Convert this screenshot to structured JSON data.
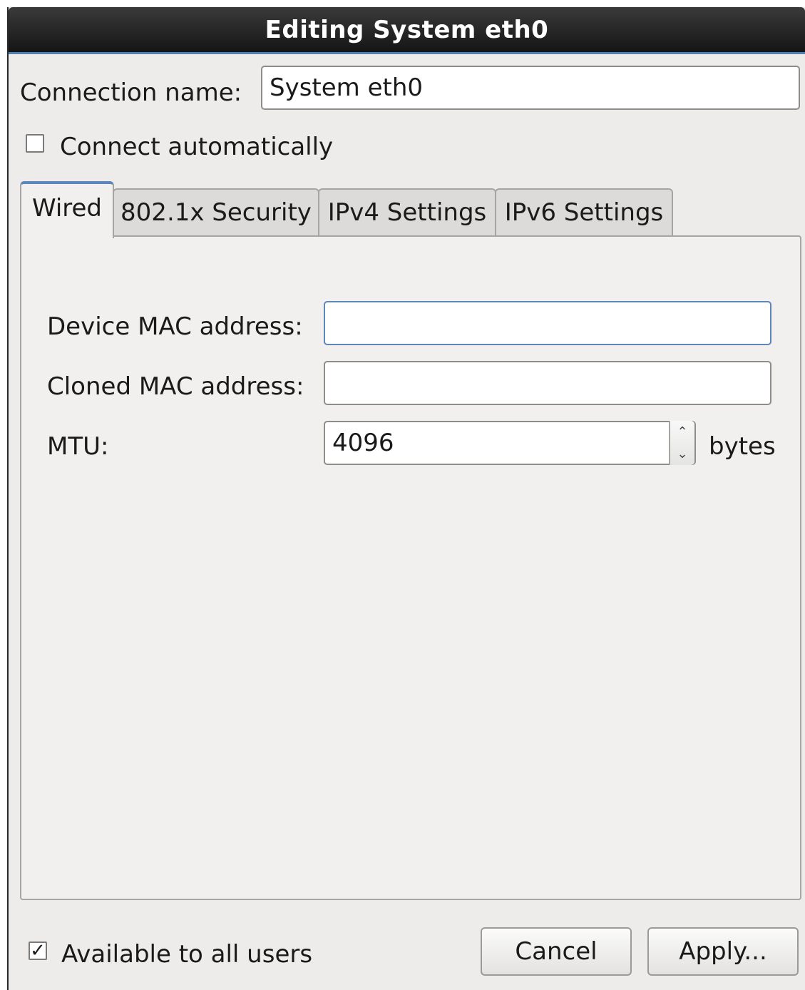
{
  "window": {
    "title": "Editing System eth0"
  },
  "connection": {
    "name_label": "Connection name:",
    "name_value": "System eth0",
    "connect_auto_label": "Connect automatically",
    "connect_auto_checked": false
  },
  "tabs": [
    {
      "label": "Wired",
      "active": true
    },
    {
      "label": "802.1x Security",
      "active": false
    },
    {
      "label": "IPv4 Settings",
      "active": false
    },
    {
      "label": "IPv6 Settings",
      "active": false
    }
  ],
  "wired": {
    "device_mac_label": "Device MAC address:",
    "device_mac_value": "",
    "cloned_mac_label": "Cloned MAC address:",
    "cloned_mac_value": "",
    "mtu_label": "MTU:",
    "mtu_value": "4096",
    "mtu_unit": "bytes"
  },
  "footer": {
    "all_users_label": "Available to all users",
    "all_users_checked": true,
    "cancel_label": "Cancel",
    "apply_label": "Apply..."
  },
  "glyphs": {
    "check": "✓",
    "spin_up": "⌃",
    "spin_down": "⌄"
  }
}
